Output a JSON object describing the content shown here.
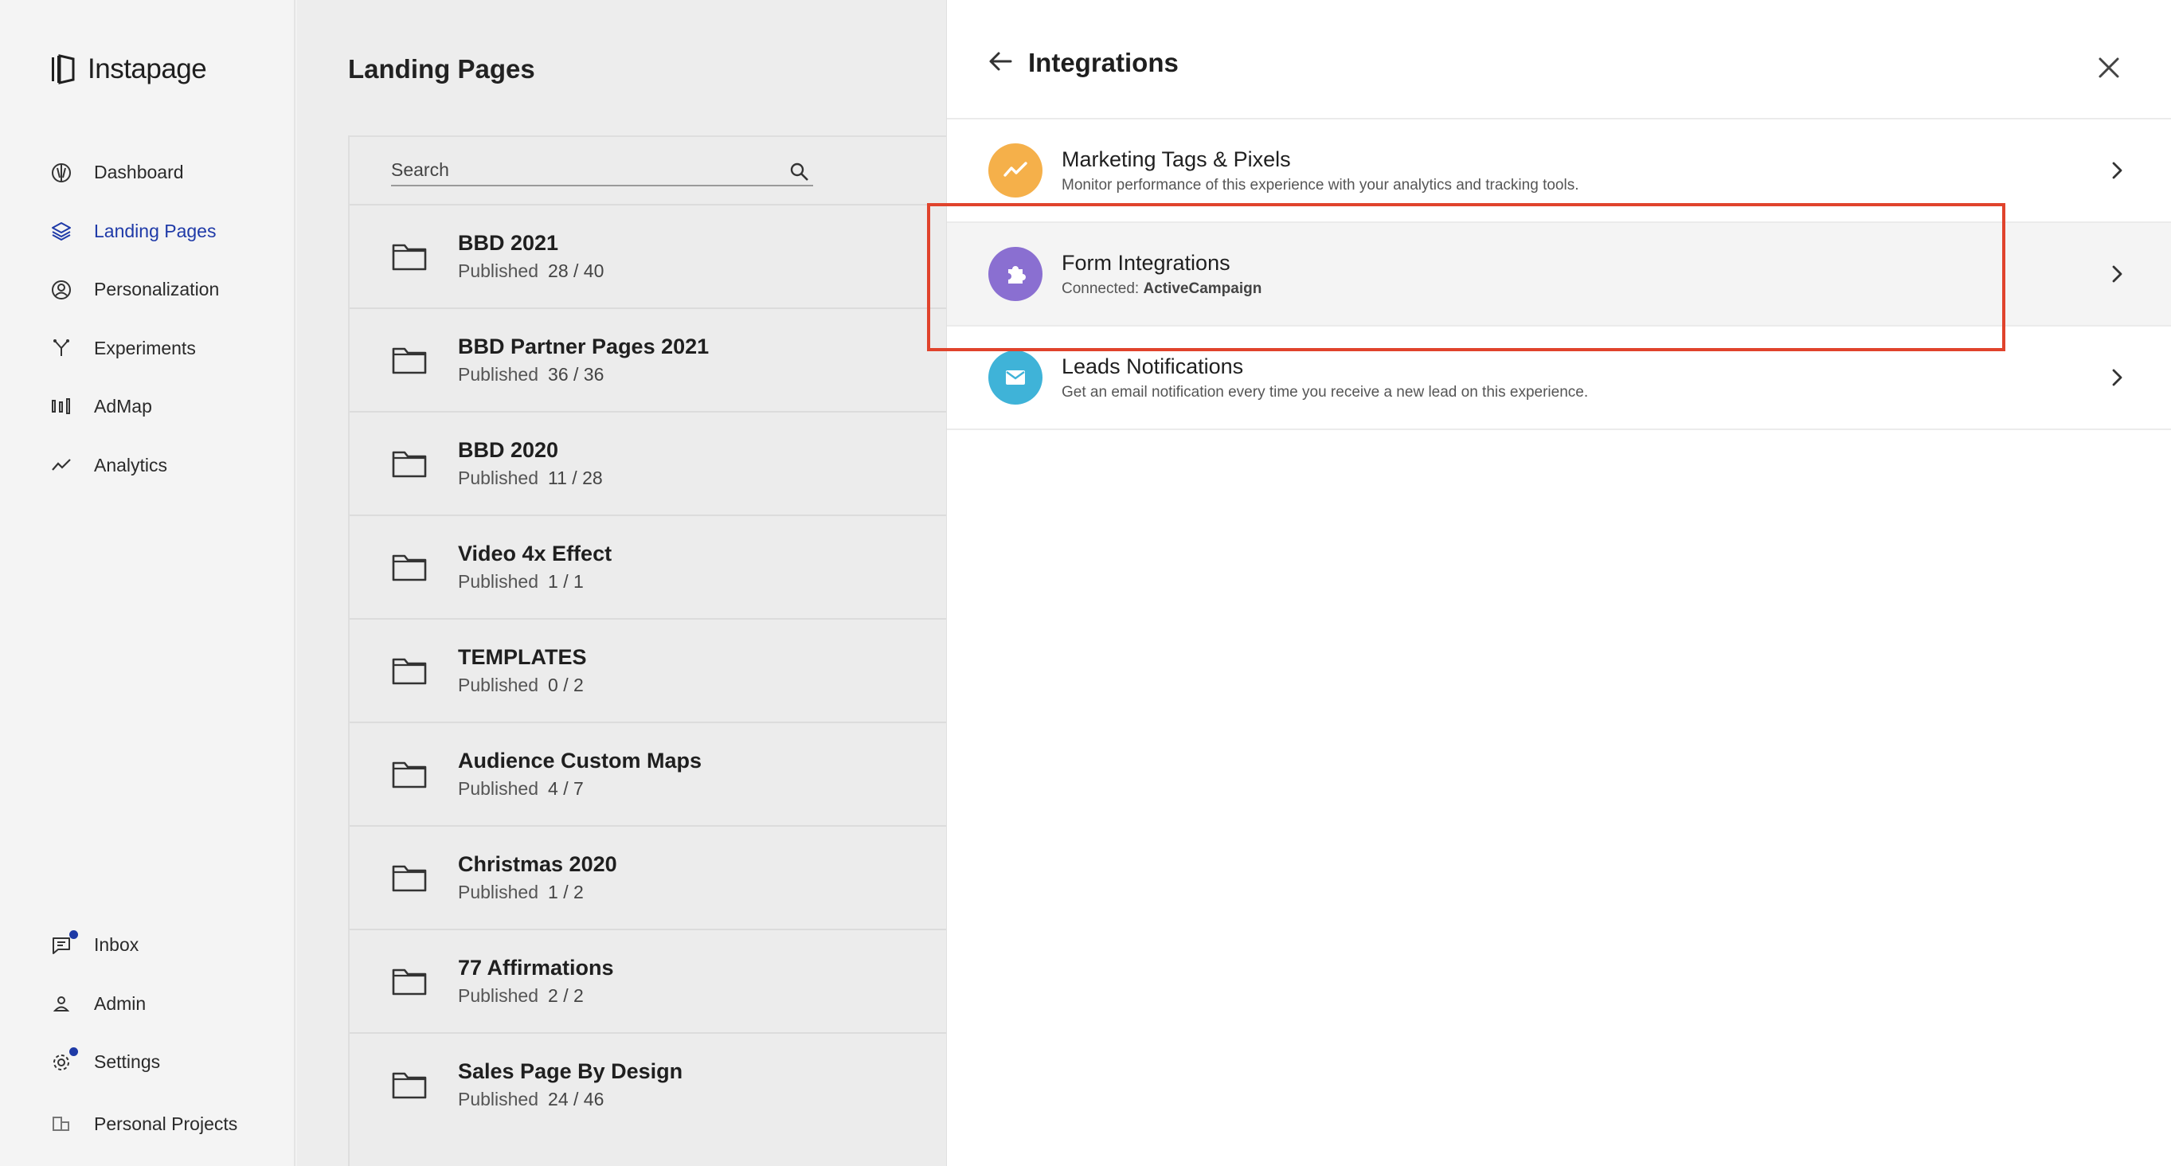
{
  "app": {
    "logo_text": "Instapage"
  },
  "sidebar": {
    "items": [
      {
        "key": "dashboard",
        "label": "Dashboard",
        "icon": "dashboard-icon",
        "active": false
      },
      {
        "key": "landing-pages",
        "label": "Landing Pages",
        "icon": "layers-icon",
        "active": true
      },
      {
        "key": "personalization",
        "label": "Personalization",
        "icon": "user-target-icon",
        "active": false
      },
      {
        "key": "experiments",
        "label": "Experiments",
        "icon": "branch-icon",
        "active": false
      },
      {
        "key": "admap",
        "label": "AdMap",
        "icon": "admap-icon",
        "active": false
      },
      {
        "key": "analytics",
        "label": "Analytics",
        "icon": "trend-line-icon",
        "active": false
      }
    ],
    "bottom_items": [
      {
        "key": "inbox",
        "label": "Inbox",
        "icon": "chat-icon",
        "badge": true
      },
      {
        "key": "admin",
        "label": "Admin",
        "icon": "person-icon",
        "badge": false
      },
      {
        "key": "settings",
        "label": "Settings",
        "icon": "gear-icon",
        "badge": true
      },
      {
        "key": "personal-projects",
        "label": "Personal Projects",
        "icon": "building-icon",
        "badge": false
      }
    ]
  },
  "main": {
    "title": "Landing Pages",
    "search": {
      "placeholder": "Search",
      "value": ""
    },
    "status_label": "Published",
    "folders": [
      {
        "name": "BBD 2021",
        "published": 28,
        "total": 40
      },
      {
        "name": "BBD Partner Pages 2021",
        "published": 36,
        "total": 36
      },
      {
        "name": "BBD 2020",
        "published": 11,
        "total": 28
      },
      {
        "name": "Video 4x Effect",
        "published": 1,
        "total": 1
      },
      {
        "name": "TEMPLATES",
        "published": 0,
        "total": 2
      },
      {
        "name": "Audience Custom Maps",
        "published": 4,
        "total": 7
      },
      {
        "name": "Christmas 2020",
        "published": 1,
        "total": 2
      },
      {
        "name": "77 Affirmations",
        "published": 2,
        "total": 2
      },
      {
        "name": "Sales Page By Design",
        "published": 24,
        "total": 46
      }
    ]
  },
  "panel": {
    "title": "Integrations",
    "items": [
      {
        "title": "Marketing Tags & Pixels",
        "subtitle": "Monitor performance of this experience with your analytics and tracking tools.",
        "icon": "trend-icon",
        "color": "#f5b04a"
      },
      {
        "title": "Form Integrations",
        "subtitle_prefix": "Connected: ",
        "subtitle_strong": "ActiveCampaign",
        "icon": "puzzle-icon",
        "color": "#8a6fd1"
      },
      {
        "title": "Leads Notifications",
        "subtitle": "Get an email notification every time you receive a new lead on this experience.",
        "icon": "mail-icon",
        "color": "#3fb3d8"
      }
    ]
  },
  "colors": {
    "accent": "#1f3aa8",
    "highlight": "#e0432c"
  }
}
